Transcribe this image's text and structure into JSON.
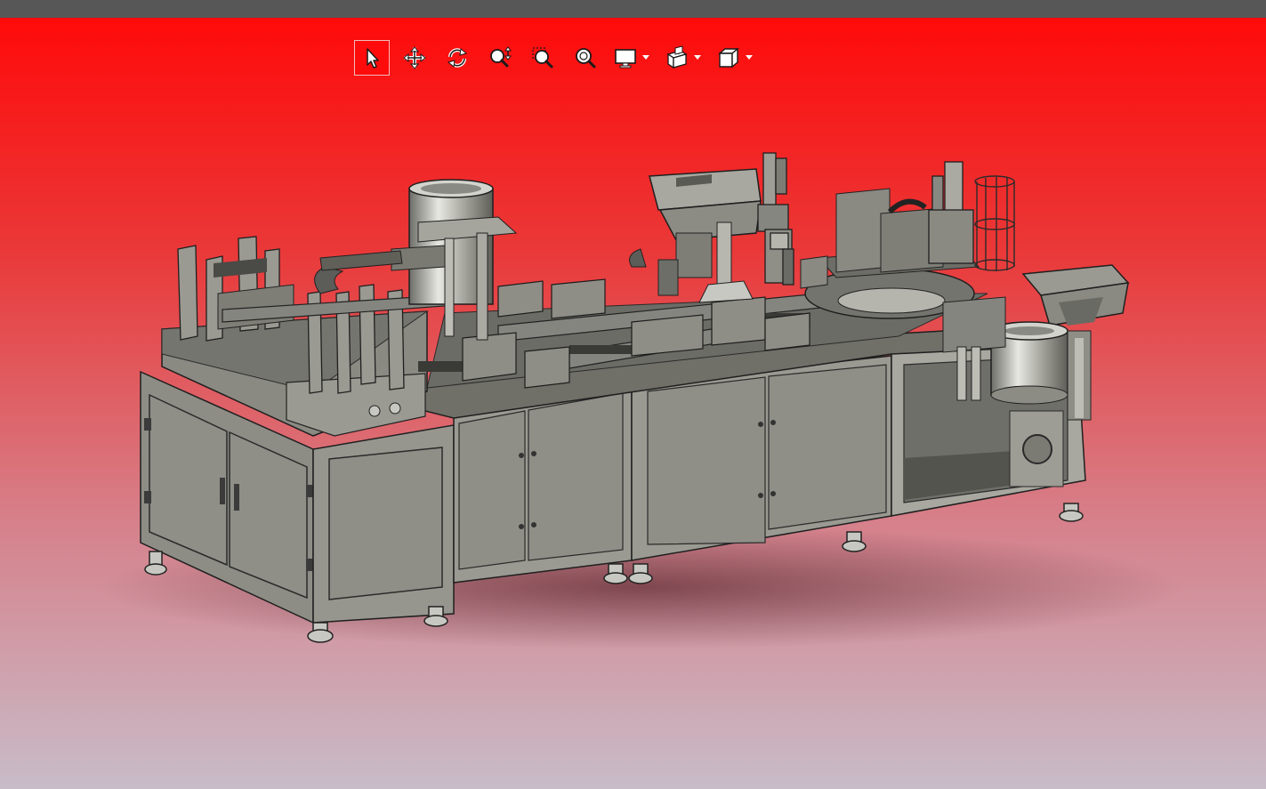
{
  "window": {
    "title": ""
  },
  "colors": {
    "background_top": "#ff0a0a",
    "background_bottom": "#c8bcc8",
    "titlebar": "#575757",
    "machine_panel": "#8f8f87",
    "machine_frame": "#a9a9a2",
    "machine_top": "#6e6e68"
  },
  "toolbar": {
    "tools": [
      {
        "name": "select",
        "icon": "pointer-icon",
        "active": true
      },
      {
        "name": "pan",
        "icon": "pan-arrows-icon",
        "active": false
      },
      {
        "name": "rotate",
        "icon": "rotate-icon",
        "active": false
      },
      {
        "name": "zoom",
        "icon": "zoom-updown-icon",
        "active": false
      },
      {
        "name": "zoom-window",
        "icon": "zoom-window-icon",
        "active": false
      },
      {
        "name": "zoom-fit",
        "icon": "zoom-fit-icon",
        "active": false
      },
      {
        "name": "display",
        "icon": "monitor-icon",
        "has_dropdown": true
      },
      {
        "name": "section",
        "icon": "section-view-icon",
        "has_dropdown": true
      },
      {
        "name": "views",
        "icon": "cube-view-icon",
        "has_dropdown": true
      }
    ]
  },
  "viewport": {
    "content": "3d-model",
    "model_icon": "assembly-machine-model"
  }
}
